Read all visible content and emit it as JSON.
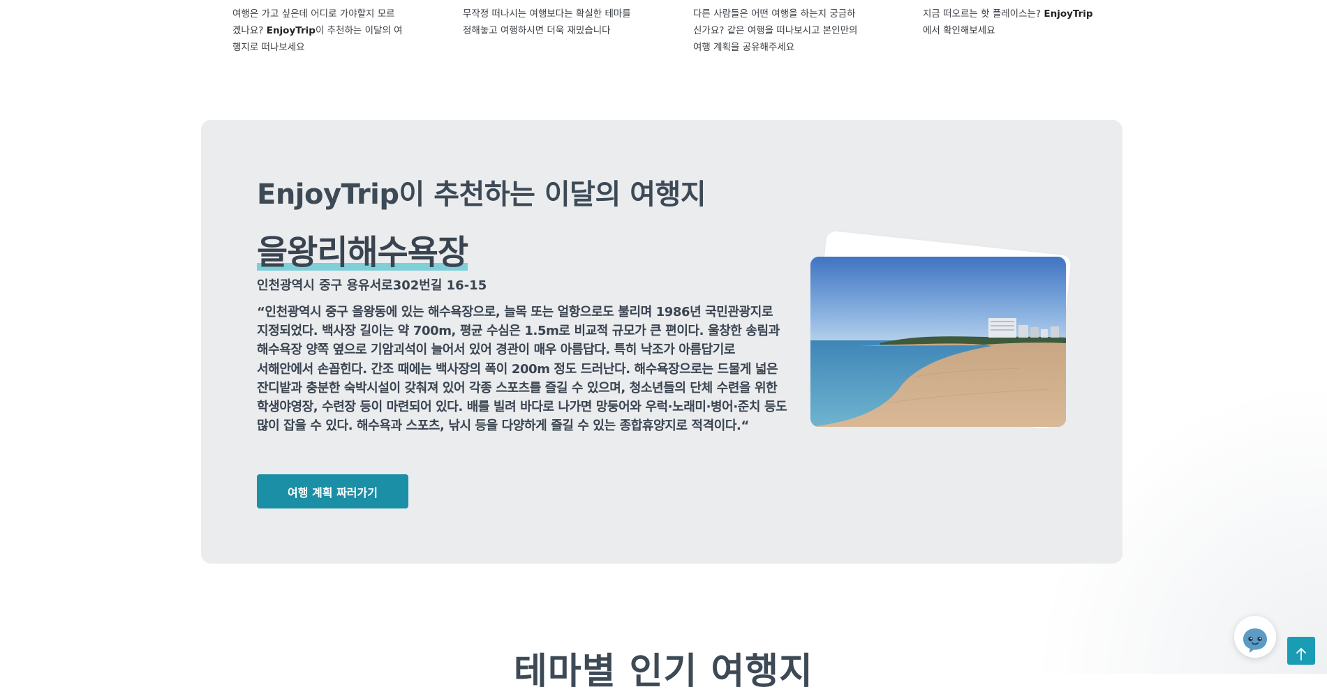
{
  "features": [
    {
      "before": "여행은 가고 싶은데 어디로 가야할지 모르겠나요? ",
      "brand": "EnjoyTrip",
      "after": "이 추천하는 이달의 여행지로 떠나보세요"
    },
    {
      "before": "무작정 떠나시는 여행보다는 확실한 테마를 정해놓고 여행하시면 더욱 재밌습니다",
      "brand": "",
      "after": ""
    },
    {
      "before": "다른 사람들은 어떤 여행을 하는지 궁금하신가요? 같은 여행을 떠나보시고 본인만의 여행 계획을 공유해주세요",
      "brand": "",
      "after": ""
    },
    {
      "before": "지금 떠오르는 핫 플레이스는? ",
      "brand": "EnjoyTrip",
      "after": "에서 확인해보세요"
    }
  ],
  "recommendation": {
    "heading": "EnjoyTrip이 추천하는 이달의 여행지",
    "place_name": "을왕리해수욕장",
    "address": "인천광역시 중구 용유서로302번길 16-15",
    "description": "“인천광역시 중구 을왕동에 있는 해수욕장으로, 늘목 또는 얼항으로도 불리며 1986년 국민관광지로 지정되었다. 백사장 길이는 약 700m, 평균 수심은 1.5m로 비교적 규모가 큰 편이다. 울창한 송림과 해수욕장 양쪽 옆으로 기암괴석이 늘어서 있어 경관이 매우 아름답다. 특히 낙조가 아름답기로 서해안에서 손꼽힌다. 간조 때에는 백사장의 폭이 200m 정도 드러난다. 해수욕장으로는 드물게 넓은 잔디밭과 충분한 숙박시설이 갖춰져 있어 각종 스포츠를 즐길 수 있으며, 청소년들의 단체 수련을 위한 학생야영장, 수련장 등이 마련되어 있다. 배를 빌려 바다로 나가면 망둥어와 우럭·노래미·병어·준치 등도 많이 잡을 수 있다. 해수욕과 스포츠, 낚시 등을 다양하게 즐길 수 있는 종합휴양지로 적격이다.“",
    "button_label": "여행 계획 짜러가기"
  },
  "next_section": {
    "title": "테마별 인기 여행지"
  },
  "floating": {
    "chatbot_icon": "chatbot-icon",
    "top_icon": "arrow-up-icon"
  },
  "colors": {
    "accent": "#1b8fa6",
    "highlight": "#7fcfd9",
    "card_bg": "#eaecee",
    "heading_text": "#3d4a56"
  }
}
